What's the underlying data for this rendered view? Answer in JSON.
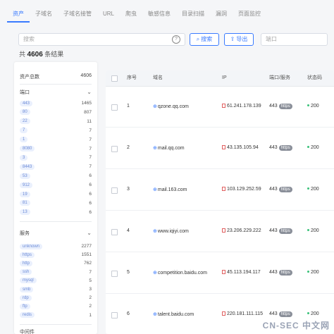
{
  "tabs": [
    {
      "label": "资产",
      "active": true
    },
    {
      "label": "子域名",
      "active": false
    },
    {
      "label": "子域名接管",
      "active": false
    },
    {
      "label": "URL",
      "active": false
    },
    {
      "label": "爬虫",
      "active": false
    },
    {
      "label": "敏感信息",
      "active": false
    },
    {
      "label": "目录扫描",
      "active": false
    },
    {
      "label": "漏洞",
      "active": false
    },
    {
      "label": "页面监控",
      "active": false
    }
  ],
  "search": {
    "placeholder": "搜索",
    "help_icon": "?"
  },
  "buttons": {
    "search_label": "搜索",
    "export_label": "导出"
  },
  "pager": {
    "placeholder": "端口"
  },
  "total": {
    "prefix": "共",
    "count": "4606",
    "suffix": "条结果"
  },
  "sidebar": {
    "stats_label": "资产总数",
    "stats_value": "4606",
    "port_title": "端口",
    "ports": [
      {
        "label": "443",
        "count": "1465"
      },
      {
        "label": "80",
        "count": "807"
      },
      {
        "label": "22",
        "count": "11"
      },
      {
        "label": "7",
        "count": "7"
      },
      {
        "label": "1",
        "count": "7"
      },
      {
        "label": "8080",
        "count": "7"
      },
      {
        "label": "3",
        "count": "7"
      },
      {
        "label": "8443",
        "count": "7"
      },
      {
        "label": "53",
        "count": "6"
      },
      {
        "label": "912",
        "count": "6"
      },
      {
        "label": "19",
        "count": "6"
      },
      {
        "label": "81",
        "count": "6"
      },
      {
        "label": "13",
        "count": "6"
      }
    ],
    "service_title": "服务",
    "services": [
      {
        "label": "unknown",
        "count": "2277"
      },
      {
        "label": "https",
        "count": "1551"
      },
      {
        "label": "http",
        "count": "762"
      },
      {
        "label": "ssh",
        "count": "7"
      },
      {
        "label": "mysql",
        "count": "5"
      },
      {
        "label": "smb",
        "count": "3"
      },
      {
        "label": "rdp",
        "count": "2"
      },
      {
        "label": "ftp",
        "count": "2"
      },
      {
        "label": "redis",
        "count": "1"
      }
    ],
    "bottom_title": "中间件"
  },
  "table": {
    "headers": {
      "index": "序号",
      "domain": "域名",
      "ip": "IP",
      "port": "端口/服务",
      "status": "状态码"
    },
    "rows": [
      {
        "index": "1",
        "domain": "qzone.qq.com",
        "ip": "61.241.178.139",
        "port": "443",
        "proto": "https",
        "status": "200"
      },
      {
        "index": "2",
        "domain": "mail.qq.com",
        "ip": "43.135.105.94",
        "port": "443",
        "proto": "https",
        "status": "200"
      },
      {
        "index": "3",
        "domain": "mail.163.com",
        "ip": "103.129.252.59",
        "port": "443",
        "proto": "https",
        "status": "200"
      },
      {
        "index": "4",
        "domain": "www.iqiyi.com",
        "ip": "23.206.229.222",
        "port": "443",
        "proto": "https",
        "status": "200"
      },
      {
        "index": "5",
        "domain": "competition.baidu.com",
        "ip": "45.113.194.117",
        "port": "443",
        "proto": "https",
        "status": "200"
      },
      {
        "index": "6",
        "domain": "talent.baidu.com",
        "ip": "220.181.111.115",
        "port": "443",
        "proto": "https",
        "status": "200"
      }
    ]
  },
  "watermark": "CN-SEC 中文网",
  "colors": {
    "accent": "#3a7bff",
    "status_ok": "#3cc27a",
    "tag_bg": "#eaf0fd"
  }
}
